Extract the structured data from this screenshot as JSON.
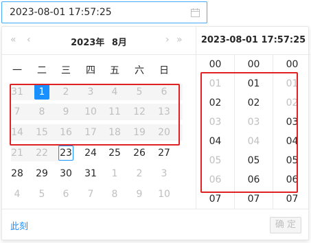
{
  "input": {
    "value": "2023-08-01 17:57:25",
    "icon": "calendar-icon"
  },
  "header": {
    "super_prev": "«",
    "prev": "‹",
    "year": "2023年",
    "month": "8月",
    "next": "›",
    "super_next": "»"
  },
  "weekdays": [
    "一",
    "二",
    "三",
    "四",
    "五",
    "六",
    "日"
  ],
  "weeks": [
    [
      {
        "d": "31",
        "t": "dim"
      },
      {
        "d": "1",
        "t": "sel"
      },
      {
        "d": "2",
        "t": "dim"
      },
      {
        "d": "3",
        "t": "dim"
      },
      {
        "d": "4",
        "t": "dim"
      },
      {
        "d": "5",
        "t": "dim"
      },
      {
        "d": "6",
        "t": "dim"
      }
    ],
    [
      {
        "d": "7",
        "t": "dim"
      },
      {
        "d": "8",
        "t": "dim"
      },
      {
        "d": "9",
        "t": "dim"
      },
      {
        "d": "10",
        "t": "dim"
      },
      {
        "d": "11",
        "t": "dim"
      },
      {
        "d": "12",
        "t": "dim"
      },
      {
        "d": "13",
        "t": "dim"
      }
    ],
    [
      {
        "d": "14",
        "t": "dim"
      },
      {
        "d": "15",
        "t": "dim"
      },
      {
        "d": "16",
        "t": "dim"
      },
      {
        "d": "17",
        "t": "dim"
      },
      {
        "d": "18",
        "t": "dim"
      },
      {
        "d": "19",
        "t": "dim"
      },
      {
        "d": "20",
        "t": "dim"
      }
    ],
    [
      {
        "d": "21",
        "t": "dim"
      },
      {
        "d": "22",
        "t": "dim"
      },
      {
        "d": "23",
        "t": "today"
      },
      {
        "d": "24",
        "t": "cur"
      },
      {
        "d": "25",
        "t": "cur"
      },
      {
        "d": "26",
        "t": "cur"
      },
      {
        "d": "27",
        "t": "cur"
      }
    ],
    [
      {
        "d": "28",
        "t": "cur"
      },
      {
        "d": "29",
        "t": "cur"
      },
      {
        "d": "30",
        "t": "cur"
      },
      {
        "d": "31",
        "t": "cur"
      },
      {
        "d": "1",
        "t": "dim"
      },
      {
        "d": "2",
        "t": "dim"
      },
      {
        "d": "3",
        "t": "dim"
      }
    ],
    [
      {
        "d": "4",
        "t": "dim"
      },
      {
        "d": "5",
        "t": "dim"
      },
      {
        "d": "6",
        "t": "dim"
      },
      {
        "d": "7",
        "t": "dim"
      },
      {
        "d": "8",
        "t": "dim"
      },
      {
        "d": "9",
        "t": "dim"
      },
      {
        "d": "10",
        "t": "dim"
      }
    ]
  ],
  "time_header": "2023-08-01 17:57:25",
  "time_columns": [
    [
      {
        "v": "00",
        "t": "cur"
      },
      {
        "v": "01",
        "t": "dim"
      },
      {
        "v": "02",
        "t": "cur"
      },
      {
        "v": "03",
        "t": "dim"
      },
      {
        "v": "04",
        "t": "cur"
      },
      {
        "v": "05",
        "t": "dim"
      },
      {
        "v": "06",
        "t": "dim"
      },
      {
        "v": "07",
        "t": "cur"
      }
    ],
    [
      {
        "v": "00",
        "t": "cur"
      },
      {
        "v": "01",
        "t": "cur"
      },
      {
        "v": "02",
        "t": "cur"
      },
      {
        "v": "03",
        "t": "dim"
      },
      {
        "v": "04",
        "t": "dim"
      },
      {
        "v": "05",
        "t": "cur"
      },
      {
        "v": "06",
        "t": "cur"
      },
      {
        "v": "07",
        "t": "cur"
      }
    ],
    [
      {
        "v": "00",
        "t": "cur"
      },
      {
        "v": "01",
        "t": "dim"
      },
      {
        "v": "02",
        "t": "dim"
      },
      {
        "v": "03",
        "t": "cur"
      },
      {
        "v": "04",
        "t": "cur"
      },
      {
        "v": "05",
        "t": "cur"
      },
      {
        "v": "06",
        "t": "cur"
      },
      {
        "v": "07",
        "t": "cur"
      }
    ]
  ],
  "footer": {
    "now_label": "此刻",
    "ok_label": "确 定"
  },
  "colors": {
    "accent": "#1890ff",
    "highlight_box": "#e02020",
    "disabled_text": "#bfbfbf"
  }
}
